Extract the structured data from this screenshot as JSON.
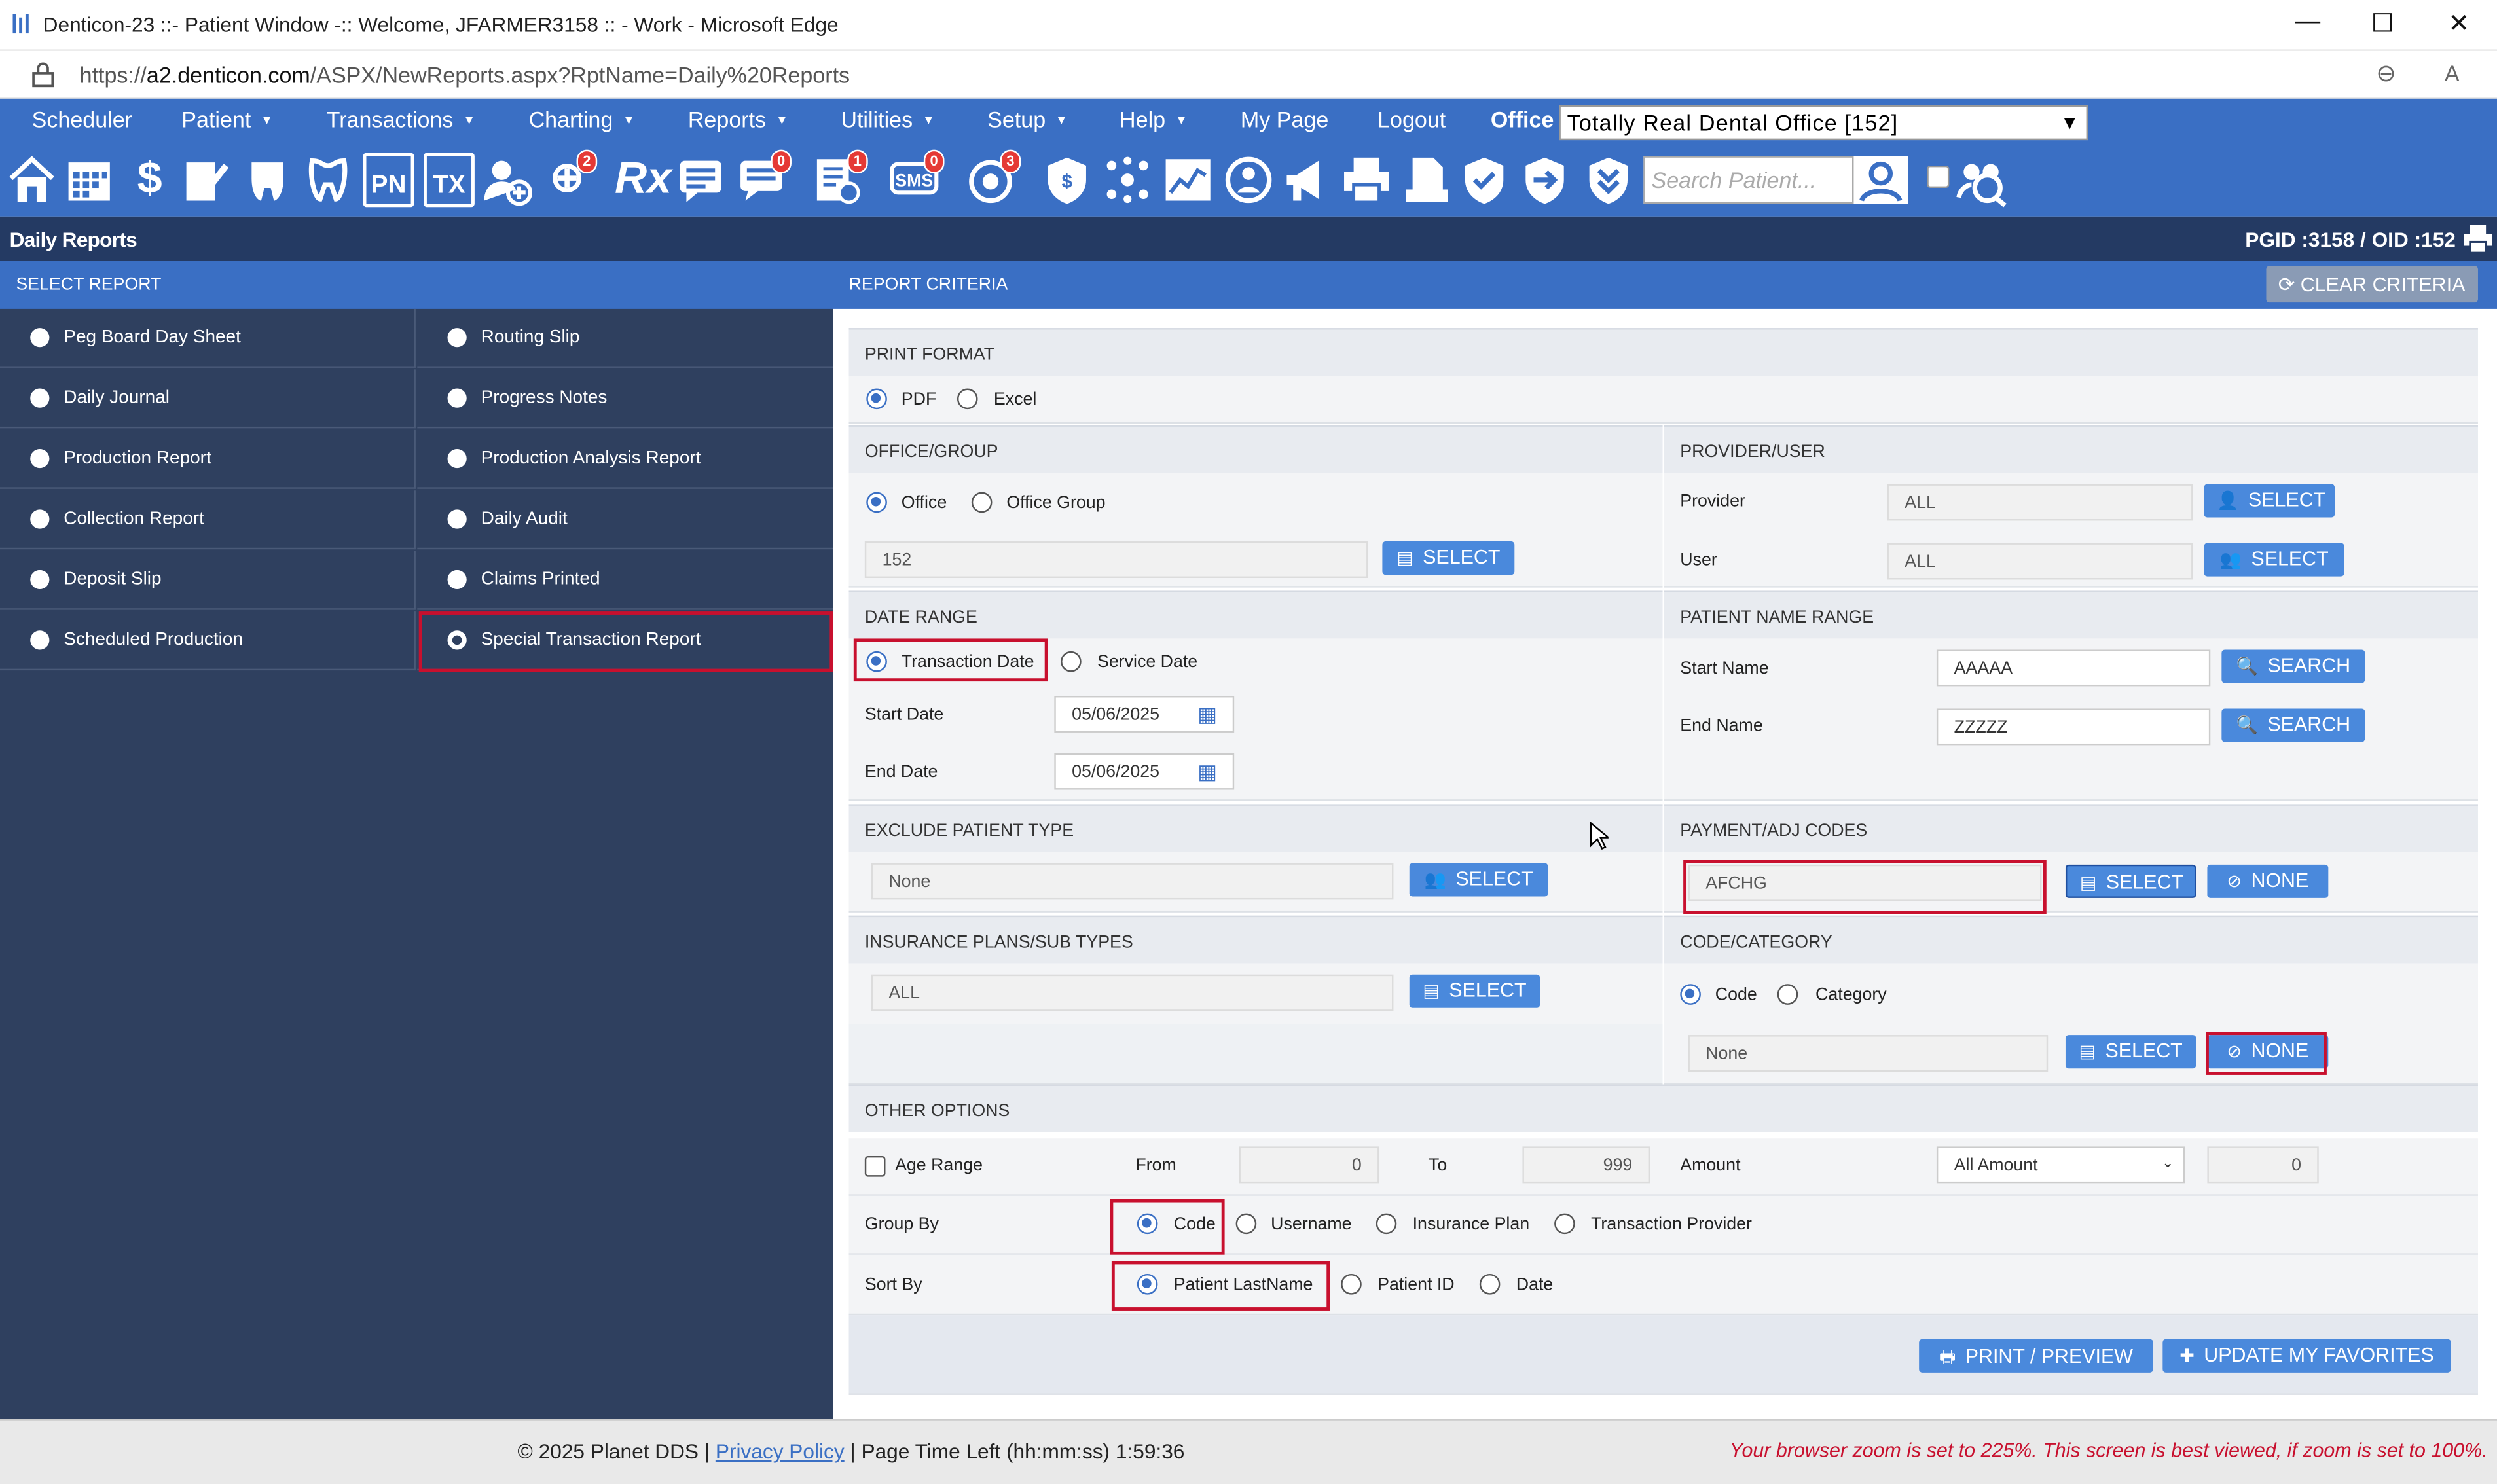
{
  "window": {
    "title": "Denticon-23 ::- Patient Window -:: Welcome, JFARMER3158 :: - Work - Microsoft Edge",
    "url_prefix": "https://",
    "url_domain": "a2.denticon.com",
    "url_path": "/ASPX/NewReports.aspx?RptName=Daily%20Reports"
  },
  "nav": {
    "items": [
      "Scheduler",
      "Patient",
      "Transactions",
      "Charting",
      "Reports",
      "Utilities",
      "Setup",
      "Help",
      "My Page",
      "Logout"
    ],
    "office_label": "Office",
    "office_value": "Totally Real Dental Office [152]"
  },
  "toolbar": {
    "search_placeholder": "Search Patient...",
    "badges": {
      "globe": "2",
      "chat": "0",
      "notes": "1",
      "sms": "0",
      "alert": "3"
    }
  },
  "header": {
    "title": "Daily Reports",
    "ids": "PGID :3158  /  OID :152"
  },
  "select_report": {
    "heading": "SELECT REPORT",
    "left": [
      "Peg Board Day Sheet",
      "Daily Journal",
      "Production Report",
      "Collection Report",
      "Deposit Slip",
      "Scheduled Production"
    ],
    "right": [
      "Routing Slip",
      "Progress Notes",
      "Production Analysis Report",
      "Daily Audit",
      "Claims Printed",
      "Special Transaction Report"
    ],
    "selected": "Special Transaction Report"
  },
  "criteria": {
    "heading": "REPORT CRITERIA",
    "clear_label": "CLEAR CRITERIA",
    "print_format": {
      "title": "PRINT FORMAT",
      "pdf": "PDF",
      "excel": "Excel",
      "selected": "PDF"
    },
    "office_group": {
      "title": "OFFICE/GROUP",
      "office": "Office",
      "group": "Office Group",
      "value": "152",
      "select": "SELECT"
    },
    "provider_user": {
      "title": "PROVIDER/USER",
      "provider_label": "Provider",
      "provider_value": "ALL",
      "user_label": "User",
      "user_value": "ALL",
      "select": "SELECT"
    },
    "date_range": {
      "title": "DATE RANGE",
      "transaction": "Transaction Date",
      "service": "Service Date",
      "start_label": "Start Date",
      "start": "05/06/2025",
      "end_label": "End Date",
      "end": "05/06/2025"
    },
    "name_range": {
      "title": "PATIENT NAME RANGE",
      "start_label": "Start Name",
      "start": "AAAAA",
      "end_label": "End Name",
      "end": "ZZZZZ",
      "search": "SEARCH"
    },
    "exclude": {
      "title": "EXCLUDE PATIENT TYPE",
      "value": "None",
      "select": "SELECT"
    },
    "payment": {
      "title": "PAYMENT/ADJ CODES",
      "value": "AFCHG",
      "select": "SELECT",
      "none": "NONE"
    },
    "insurance": {
      "title": "INSURANCE PLANS/SUB TYPES",
      "value": "ALL",
      "select": "SELECT"
    },
    "code_category": {
      "title": "CODE/CATEGORY",
      "code": "Code",
      "category": "Category",
      "value": "None",
      "select": "SELECT",
      "none": "NONE"
    },
    "other": {
      "title": "OTHER OPTIONS",
      "age_range": "Age Range",
      "from_label": "From",
      "from": "0",
      "to_label": "To",
      "to": "999",
      "amount_label": "Amount",
      "amount_select": "All Amount",
      "amount_value": "0",
      "group_by": "Group By",
      "group_opts": [
        "Code",
        "Username",
        "Insurance Plan",
        "Transaction Provider"
      ],
      "sort_by": "Sort By",
      "sort_opts": [
        "Patient LastName",
        "Patient ID",
        "Date"
      ]
    },
    "print_label": "PRINT / PREVIEW",
    "favorites_label": "UPDATE MY FAVORITES"
  },
  "footer": {
    "copyright": "© 2025 Planet DDS |",
    "privacy": "Privacy Policy",
    "time": "|  Page Time Left (hh:mm:ss) 1:59:36",
    "warning": "Your browser zoom is set to 225%. This screen is best viewed, if zoom is set to 100%."
  },
  "colors": {
    "nav": "#3a6fc4",
    "panel": "#2f405f",
    "header": "#243a63",
    "button": "#4a89dc",
    "highlight": "#c8102e"
  }
}
